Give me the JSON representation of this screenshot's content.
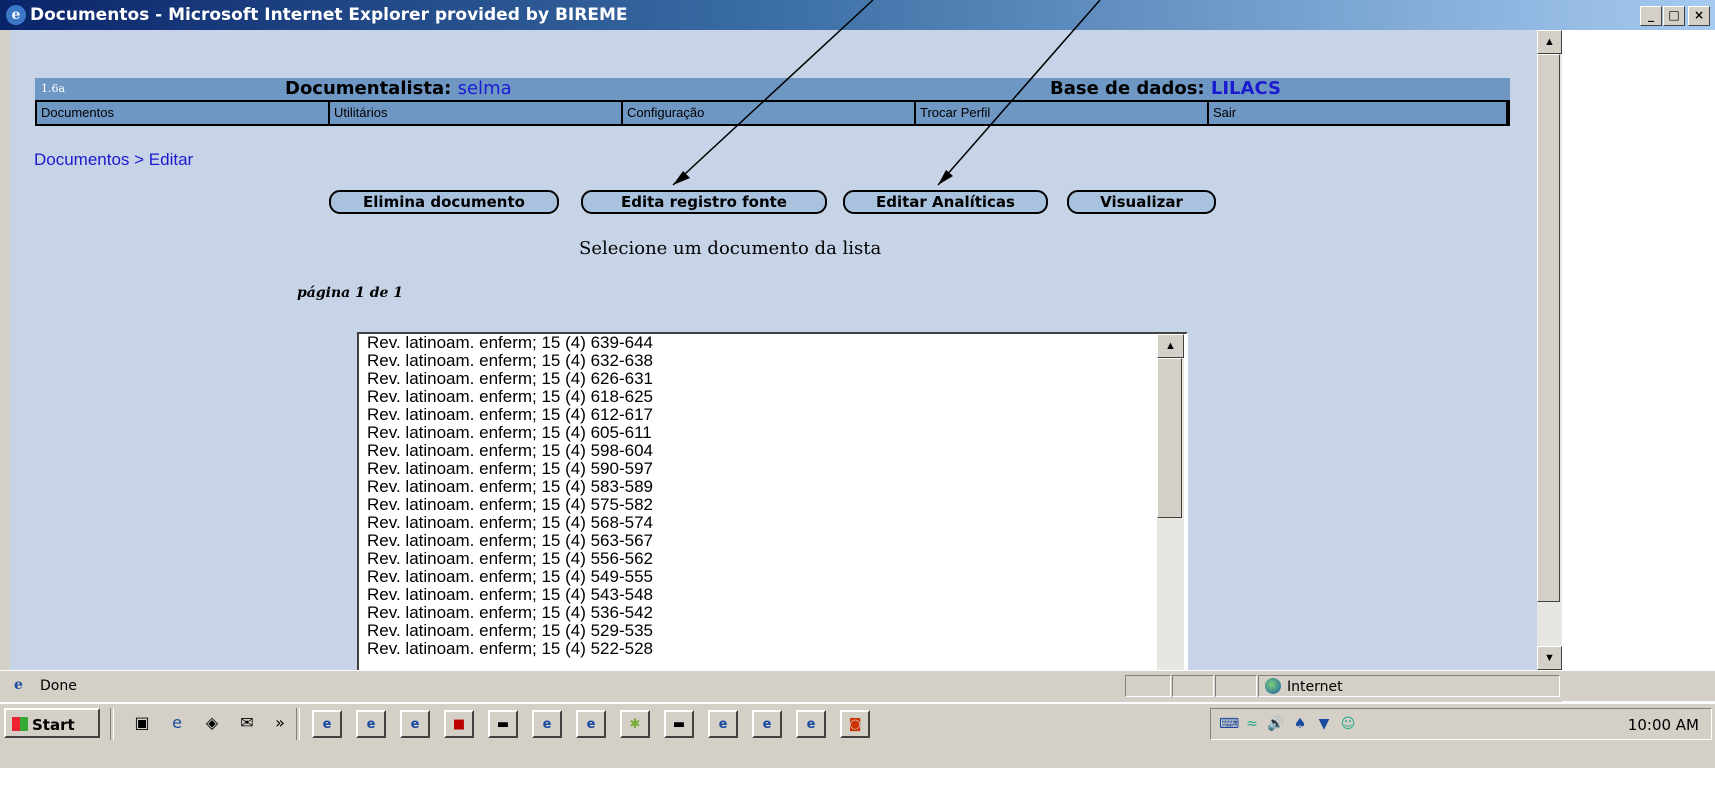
{
  "window": {
    "title": "Documentos - Microsoft Internet Explorer provided by BIREME",
    "minimize": "_",
    "maximize": "□",
    "close": "×"
  },
  "header": {
    "version": "1.6a",
    "documentalista_label": "Documentalista:",
    "documentalista_value": "selma",
    "base_label": "Base de dados:",
    "base_value": "LILACS"
  },
  "menu": [
    "Documentos",
    "Utilitários",
    "Configuração",
    "Trocar Perfil",
    "Sair"
  ],
  "breadcrumb": "Documentos > Editar",
  "actions": {
    "elimina": "Elimina documento",
    "edita_fonte": "Edita registro fonte",
    "editar_analiticas": "Editar Analíticas",
    "visualizar": "Visualizar"
  },
  "instruction": "Selecione um documento da lista",
  "pagination": "página 1 de 1",
  "documents": [
    "Rev. latinoam. enferm; 15 (4) 639-644",
    "Rev. latinoam. enferm; 15 (4) 632-638",
    "Rev. latinoam. enferm; 15 (4) 626-631",
    "Rev. latinoam. enferm; 15 (4) 618-625",
    "Rev. latinoam. enferm; 15 (4) 612-617",
    "Rev. latinoam. enferm; 15 (4) 605-611",
    "Rev. latinoam. enferm; 15 (4) 598-604",
    "Rev. latinoam. enferm; 15 (4) 590-597",
    "Rev. latinoam. enferm; 15 (4) 583-589",
    "Rev. latinoam. enferm; 15 (4) 575-582",
    "Rev. latinoam. enferm; 15 (4) 568-574",
    "Rev. latinoam. enferm; 15 (4) 563-567",
    "Rev. latinoam. enferm; 15 (4) 556-562",
    "Rev. latinoam. enferm; 15 (4) 549-555",
    "Rev. latinoam. enferm; 15 (4) 543-548",
    "Rev. latinoam. enferm; 15 (4) 536-542",
    "Rev. latinoam. enferm; 15 (4) 529-535",
    "Rev. latinoam. enferm; 15 (4) 522-528"
  ],
  "status": {
    "text": "Done",
    "zone": "Internet"
  },
  "taskbar": {
    "start": "Start",
    "chevron": "»",
    "clock": "10:00 AM"
  },
  "icons": {
    "ie": "ie-icon",
    "globe": "globe-icon",
    "start": "windows-flag-icon"
  },
  "colors": {
    "page_bg": "#c7d3e6",
    "header_bg": "#6f97c4",
    "link": "#1b1bd0",
    "button_bg": "#a9c3df"
  }
}
